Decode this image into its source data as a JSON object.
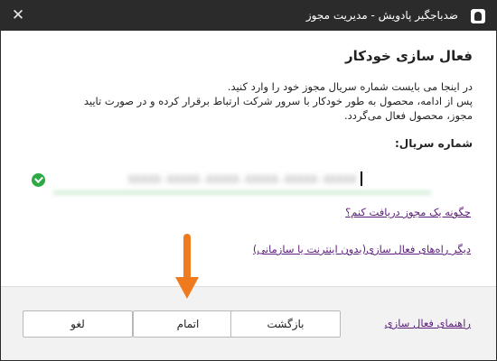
{
  "window": {
    "title": "ضدباجگیر پادویش - مدیریت مجوز",
    "close_glyph": "✕",
    "app_icon": "lock-icon"
  },
  "page": {
    "heading": "فعال سازی خودکار",
    "description_lines": [
      "در اینجا می بایست شماره سریال مجوز خود را وارد کنید.",
      "پس از ادامه، محصول به طور خودکار با سرور شرکت ارتباط برقرار کرده و در صورت تایید",
      "مجوز، محصول فعال می‌گردد."
    ],
    "serial_label": "شماره سریال:",
    "serial_value": "XXXXX-XXXXX-XXXXX-XXXXX-XXXXX-XXXXX",
    "serial_status_icon": "check-circle-icon",
    "how_to_get_link": "چگونه یک مجوز دریافت کنم؟",
    "other_methods_link": "دیگر راه‌های فعال سازی(بدون اینترنت یا سازمانی)"
  },
  "footer": {
    "back_label": "بازگشت",
    "finish_label": "اتمام",
    "cancel_label": "لغو",
    "help_link": "راهنمای فعال سازی"
  },
  "colors": {
    "titlebar": "#2b2b2b",
    "accent_green": "#2eaa44",
    "link_purple": "#5c1e7a",
    "arrow_orange": "#f07b1e",
    "footer_bg": "#f2f2f2"
  }
}
